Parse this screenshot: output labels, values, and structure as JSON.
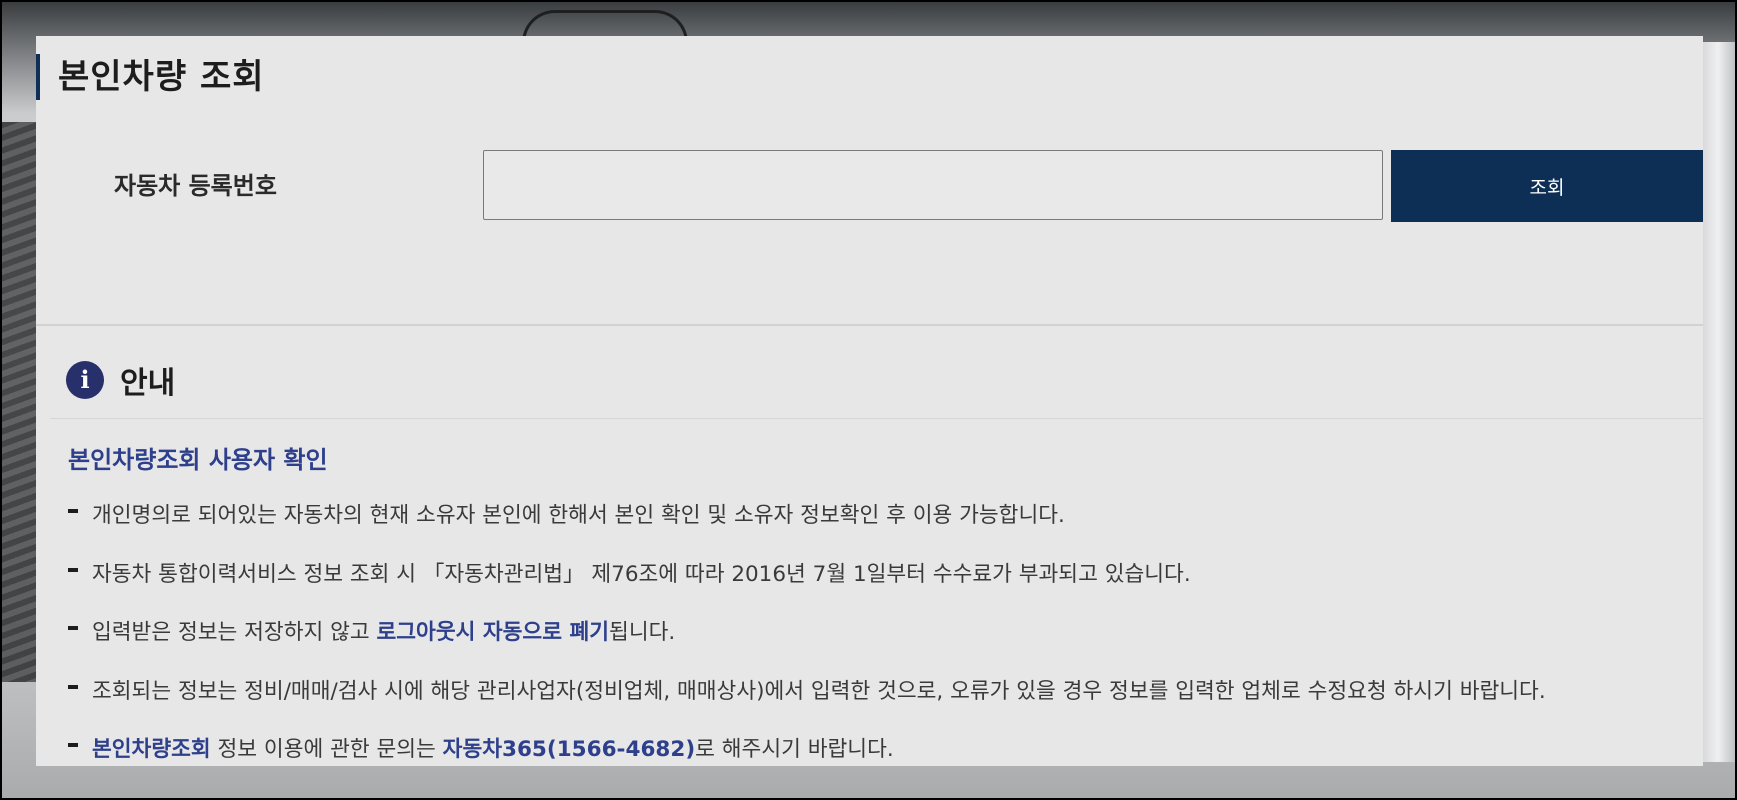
{
  "page": {
    "title": "본인차량 조회"
  },
  "search": {
    "label": "자동차 등록번호",
    "input_value": "",
    "placeholder": "",
    "button_label": "조회"
  },
  "notice": {
    "icon": "info-icon",
    "title": "안내",
    "subheading": "본인차량조회 사용자 확인",
    "items": [
      {
        "segments": [
          {
            "text": "개인명의로 되어있는 자동차의 현재 소유자 본인에 한해서 본인 확인 및 소유자 정보확인 후 이용 가능합니다.",
            "highlight": false
          }
        ]
      },
      {
        "segments": [
          {
            "text": "자동차 통합이력서비스 정보 조회 시 「자동차관리법」 제76조에 따라 2016년 7월 1일부터 수수료가 부과되고 있습니다.",
            "highlight": false
          }
        ]
      },
      {
        "segments": [
          {
            "text": "입력받은 정보는 저장하지 않고 ",
            "highlight": false
          },
          {
            "text": "로그아웃시 자동으로 폐기",
            "highlight": true
          },
          {
            "text": "됩니다.",
            "highlight": false
          }
        ]
      },
      {
        "segments": [
          {
            "text": "조회되는 정보는 정비/매매/검사 시에 해당 관리사업자(정비업체, 매매상사)에서 입력한 것으로, 오류가 있을 경우 정보를 입력한 업체로 수정요청 하시기 바랍니다.",
            "highlight": false
          }
        ]
      },
      {
        "segments": [
          {
            "text": "본인차량조회",
            "highlight": true
          },
          {
            "text": " 정보 이용에 관한 문의는 ",
            "highlight": false
          },
          {
            "text": "자동차365(1566-4682)",
            "highlight": true
          },
          {
            "text": "로 해주시기 바랍니다.",
            "highlight": false
          }
        ]
      }
    ]
  },
  "colors": {
    "accent_navy": "#0e2f55",
    "highlight_blue": "#2e3f8c",
    "panel_bg": "#e7e7e7"
  }
}
